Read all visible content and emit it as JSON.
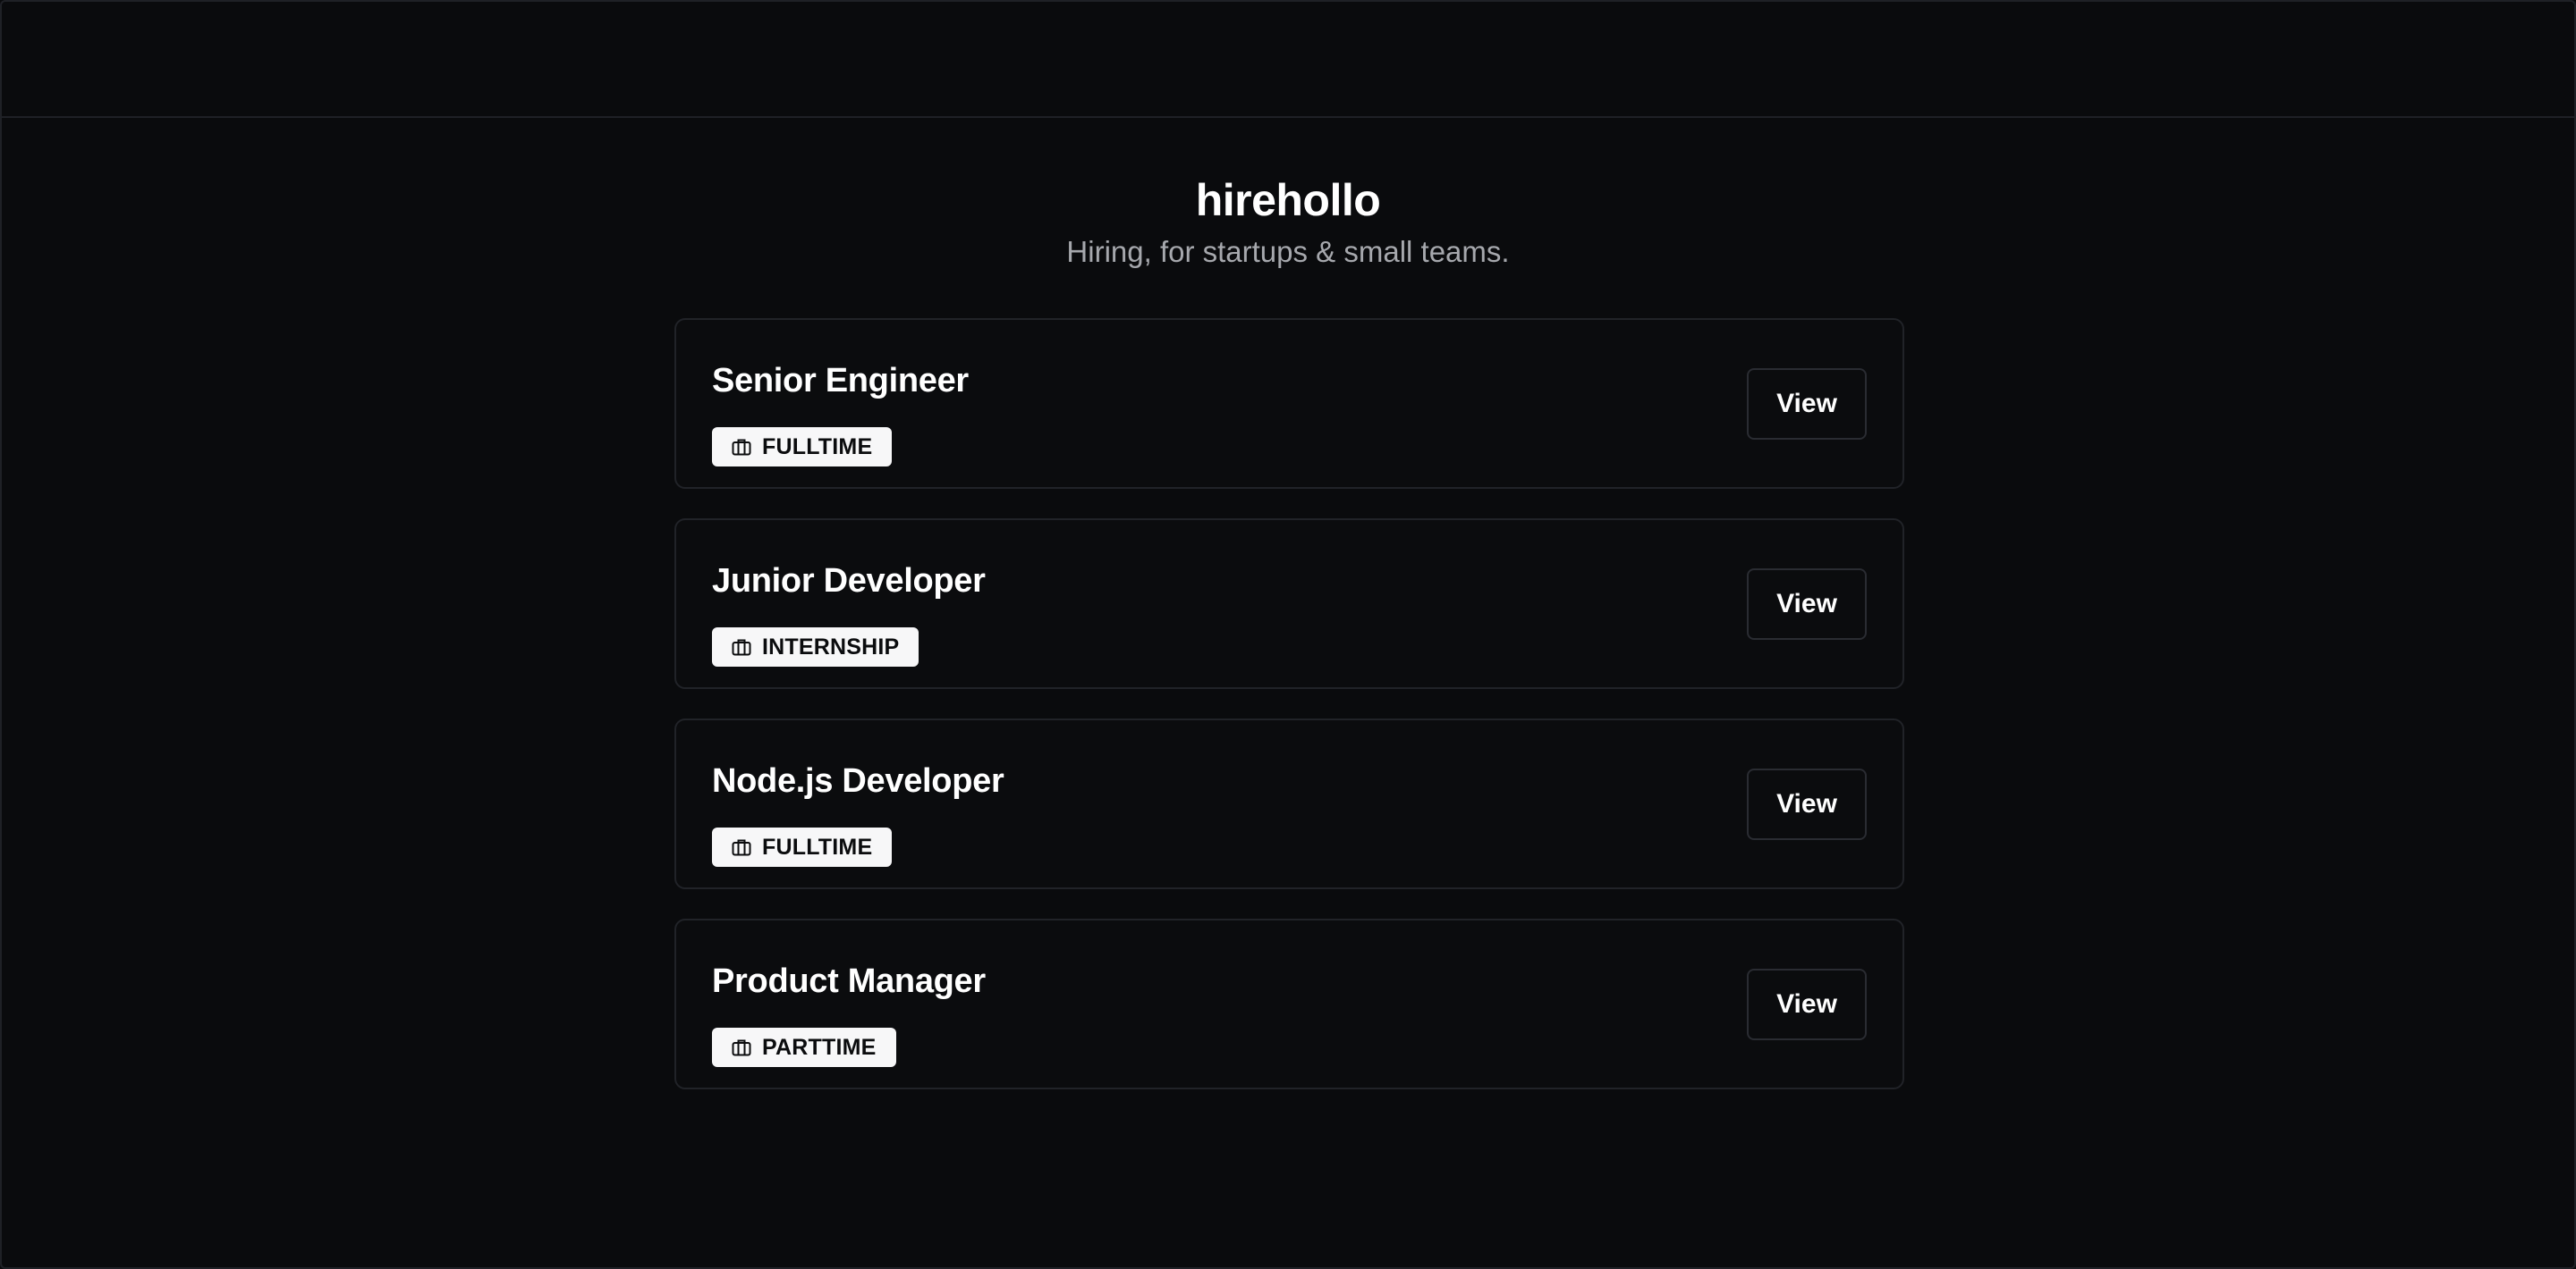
{
  "header": {
    "brand": "hirehollo",
    "tagline": "Hiring, for startups & small teams."
  },
  "jobs": [
    {
      "title": "Senior Engineer",
      "type": "FULLTIME",
      "type_icon": "briefcase-icon",
      "action_label": "View"
    },
    {
      "title": "Junior Developer",
      "type": "INTERNSHIP",
      "type_icon": "briefcase-icon",
      "action_label": "View"
    },
    {
      "title": "Node.js Developer",
      "type": "FULLTIME",
      "type_icon": "briefcase-icon",
      "action_label": "View"
    },
    {
      "title": "Product Manager",
      "type": "PARTTIME",
      "type_icon": "briefcase-icon",
      "action_label": "View"
    }
  ],
  "colors": {
    "background": "#0a0b0d",
    "card_border": "#212328",
    "badge_bg": "#f7f7f8",
    "muted_text": "#a6a8ad"
  }
}
